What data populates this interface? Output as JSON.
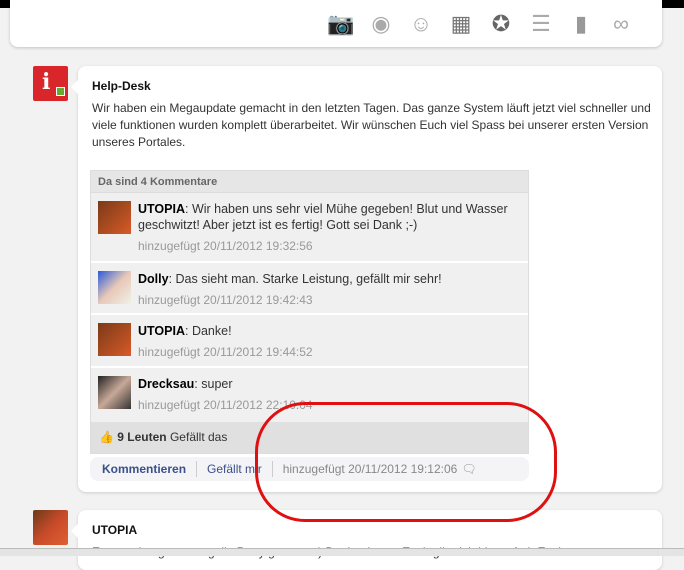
{
  "toolbar": {
    "icons": [
      "camera-icon",
      "video-icon",
      "group-icon",
      "calendar-icon",
      "globe-star-icon",
      "chart-icon",
      "document-icon",
      "link-icon"
    ]
  },
  "post": {
    "author": "Help-Desk",
    "text": "Wir haben ein Megaupdate gemacht in den letzten Tagen. Das ganze System läuft jetzt viel schneller und viele funktionen wurden komplett überarbeitet. Wir wünschen Euch viel Spass bei unserer ersten Version unseres Portales.",
    "comments_header": "Da sind 4 Kommentare",
    "comments": [
      {
        "author": "UTOPIA",
        "text": ": Wir haben uns sehr viel Mühe gegeben! Blut und Wasser geschwitzt! Aber jetzt ist es fertig! Gott sei Dank ;-)",
        "time": "hinzugefügt 20/11/2012 19:32:56"
      },
      {
        "author": "Dolly",
        "text": ": Das sieht man. Starke Leistung, gefällt mir sehr!",
        "time": "hinzugefügt 20/11/2012 19:42:43"
      },
      {
        "author": "UTOPIA",
        "text": ": Danke!",
        "time": "hinzugefügt 20/11/2012 19:44:52"
      },
      {
        "author": "Drecksau",
        "text": ": super",
        "time": "hinzugefügt 20/11/2012 22:10:04"
      }
    ],
    "likes_count": "9 Leuten",
    "likes_text": " Gefällt das",
    "comment_link": "Kommentieren",
    "like_link": "Gefällt mir",
    "time": "hinzugefügt 20/11/2012 19:12:06"
  },
  "post2": {
    "author": "UTOPIA",
    "text": "Es war eine grausam geile Party gestern : ) Danke das es Euch gibt. Ich bin so froh Euch zu"
  },
  "colors": {
    "annotation": "#e01010",
    "link": "#3b4f8a"
  }
}
